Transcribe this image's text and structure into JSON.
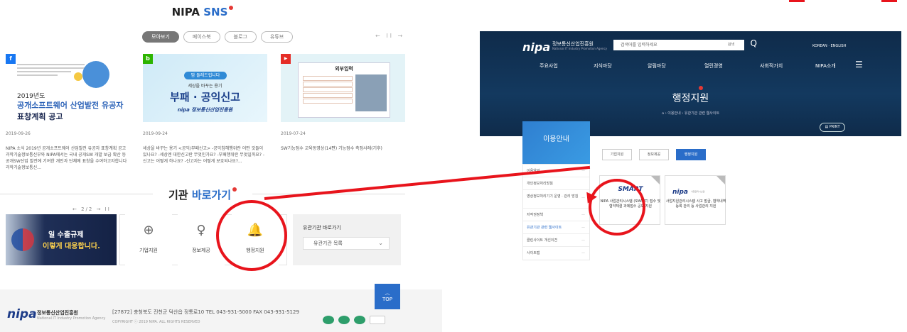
{
  "left": {
    "sns": {
      "title_pre": "NIPA",
      "title_blue": "SNS",
      "tabs": [
        "모아보기",
        "페이스북",
        "블로그",
        "유튜브"
      ],
      "pager": "← II →",
      "cards": [
        {
          "badge": "f",
          "badge_color": "#1877f2",
          "year": "2019년도",
          "title_1": "공개소프트웨어 산업발전 유공자",
          "title_2": "표창계획 공고",
          "date": "2019-09-26",
          "body": "NIPA 소식 2019년 공개소프트웨어 산업발전 유공자 표창계획 공고 과학기술정보통신부와 NIPA에서는 국내 공개SW 개발 보급 확산 등 공개SW산업 발전에 기여한 개인과 단체에 표창을 수여하고자합니다 과학기술정보통신..."
        },
        {
          "badge": "b",
          "badge_color": "#2db400",
          "pill": "맘 둘레드립니다",
          "sub": "세상을 바꾸는 용기",
          "big": "부패 · 공익신고",
          "logo": "nipa 정보통신산업진흥원",
          "date": "2019-09-24",
          "body": "세상을 바꾸는 용기 <공익/부패신고> -공익침해행위란 어떤 것들이 있나요? -세상엔 대한신고란 무엇인가요? -부패행위란 무엇일까요? -신고는 어떻게 하나요? -신고자는 어떻게 보호되나요?..."
        },
        {
          "badge": "▶",
          "badge_color": "#e52d27",
          "sheet_title": "외부입력",
          "date": "2019-07-24",
          "body": "SW기능점수 교육동영상(14편) 기능점수 측정사례(기후)"
        }
      ]
    },
    "kigwan": {
      "title_pre": "기관",
      "title_blue": "바로가기",
      "banner_nav": "← 2/2 → II",
      "banner_line1": "일 수출규제",
      "banner_line2": "이렇게 대응합니다.",
      "quick": [
        {
          "label": "기업지원",
          "icon": "globe-icon",
          "glyph": "⊕"
        },
        {
          "label": "정보제공",
          "icon": "bulb-icon",
          "glyph": "♀"
        },
        {
          "label": "행정지원",
          "icon": "bell-icon",
          "glyph": "🔔"
        }
      ],
      "related_title": "유관기관 바로가기",
      "related_select": "유관기관 목록",
      "related_chevron": "⌄"
    },
    "top_label": "TOP",
    "top_arrow": "︿",
    "footer": {
      "logo": "nipa",
      "org": "정보통신산업진흥원",
      "org_en": "National IT Industry Promotion Agency",
      "address": "[27872] 충청북도 진천군 덕산읍 정통로10     TEL 043-931-5000     FAX 043-931-5129",
      "copyright": "COPYRIGHT ⓒ 2019 NIPA. ALL RIGHTS RESERVED"
    }
  },
  "right": {
    "logo": "nipa",
    "org": "정보통신산업진흥원",
    "org_en": "National IT Industry Promotion Agency",
    "search_placeholder": "검색어를 입력하세요",
    "search_btn": "검색",
    "search_icon": "Q",
    "lang": "KOREAN  ·  ENGLISH",
    "menu": [
      "주요사업",
      "지식마당",
      "알림마당",
      "열린경영",
      "사회적가치",
      "NIPA소개"
    ],
    "menu_icon": "☰",
    "title": "행정지원",
    "breadcrumb": "⌂  ›  이용안내  ›  유관기관 관련 웹사이트",
    "print": "▤ PRINT",
    "side_title": "이용안내",
    "side_items": [
      "이용약관",
      "개인정보처리방침",
      "영상정보처리기기 운영 · 관리 방침",
      "저작권정책",
      "유관기관 관련 웹사이트",
      "클린사이트 개선의견",
      "사이트맵"
    ],
    "side_more": "—",
    "tabs": [
      "기업지원",
      "정보제공",
      "행정지원"
    ],
    "card1": {
      "logo": "SMART",
      "lines": "NIPA 사업관리시스템 (SMART) 접수 및 협약체결 과제접수 공모 지원"
    },
    "card2": {
      "logo": "nipa",
      "logo_sub": "사업관리시스템",
      "lines": "사업지원관리시스템 사고 발급, 협약내역 등록 관리 등 사업관리 지원"
    }
  },
  "colors": {
    "accent": "#2a6dc9",
    "annotation_red": "#e8141c"
  }
}
